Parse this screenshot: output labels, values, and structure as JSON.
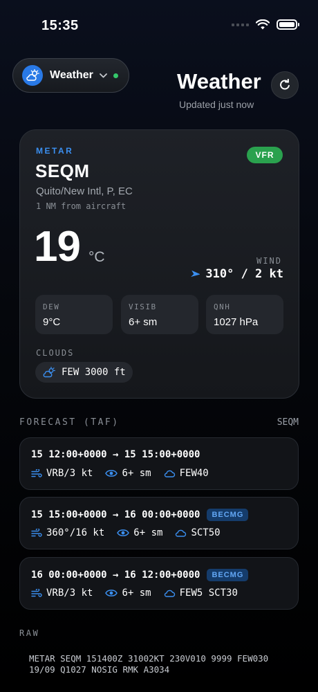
{
  "status_bar": {
    "time": "15:35"
  },
  "header": {
    "app_pill_label": "Weather",
    "title": "Weather",
    "subtitle": "Updated just now"
  },
  "metar": {
    "tag": "METAR",
    "flight_rules": "VFR",
    "station_id": "SEQM",
    "station_name": "Quito/New Intl, P, EC",
    "distance": "1 NM from aircraft",
    "temperature": "19",
    "temp_unit": "°C",
    "wind_label": "WIND",
    "wind_value": "310° / 2 kt",
    "dew_label": "DEW",
    "dew_value": "9°C",
    "visib_label": "VISIB",
    "visib_value": "6+ sm",
    "qnh_label": "QNH",
    "qnh_value": "1027 hPa",
    "clouds_label": "CLOUDS",
    "clouds_value": "FEW 3000 ft"
  },
  "forecast": {
    "label": "FORECAST (TAF)",
    "station": "SEQM",
    "periods": [
      {
        "time": "15 12:00+0000 → 15 15:00+0000",
        "badge": "",
        "wind": "VRB/3 kt",
        "visibility": "6+ sm",
        "clouds": "FEW40"
      },
      {
        "time": "15 15:00+0000 → 16 00:00+0000",
        "badge": "BECMG",
        "wind": "360°/16 kt",
        "visibility": "6+ sm",
        "clouds": "SCT50"
      },
      {
        "time": "16 00:00+0000 → 16 12:00+0000",
        "badge": "BECMG",
        "wind": "VRB/3 kt",
        "visibility": "6+ sm",
        "clouds": "FEW5 SCT30"
      }
    ]
  },
  "raw": {
    "label": "RAW",
    "text": "METAR SEQM 151400Z 31002KT 230V010 9999 FEW030 19/09 Q1027 NOSIG RMK A3034"
  },
  "colors": {
    "accent": "#3b8ff0",
    "vfr": "#2aa14e",
    "becmg_bg": "#153c6b",
    "status_dot": "#34c76a"
  }
}
